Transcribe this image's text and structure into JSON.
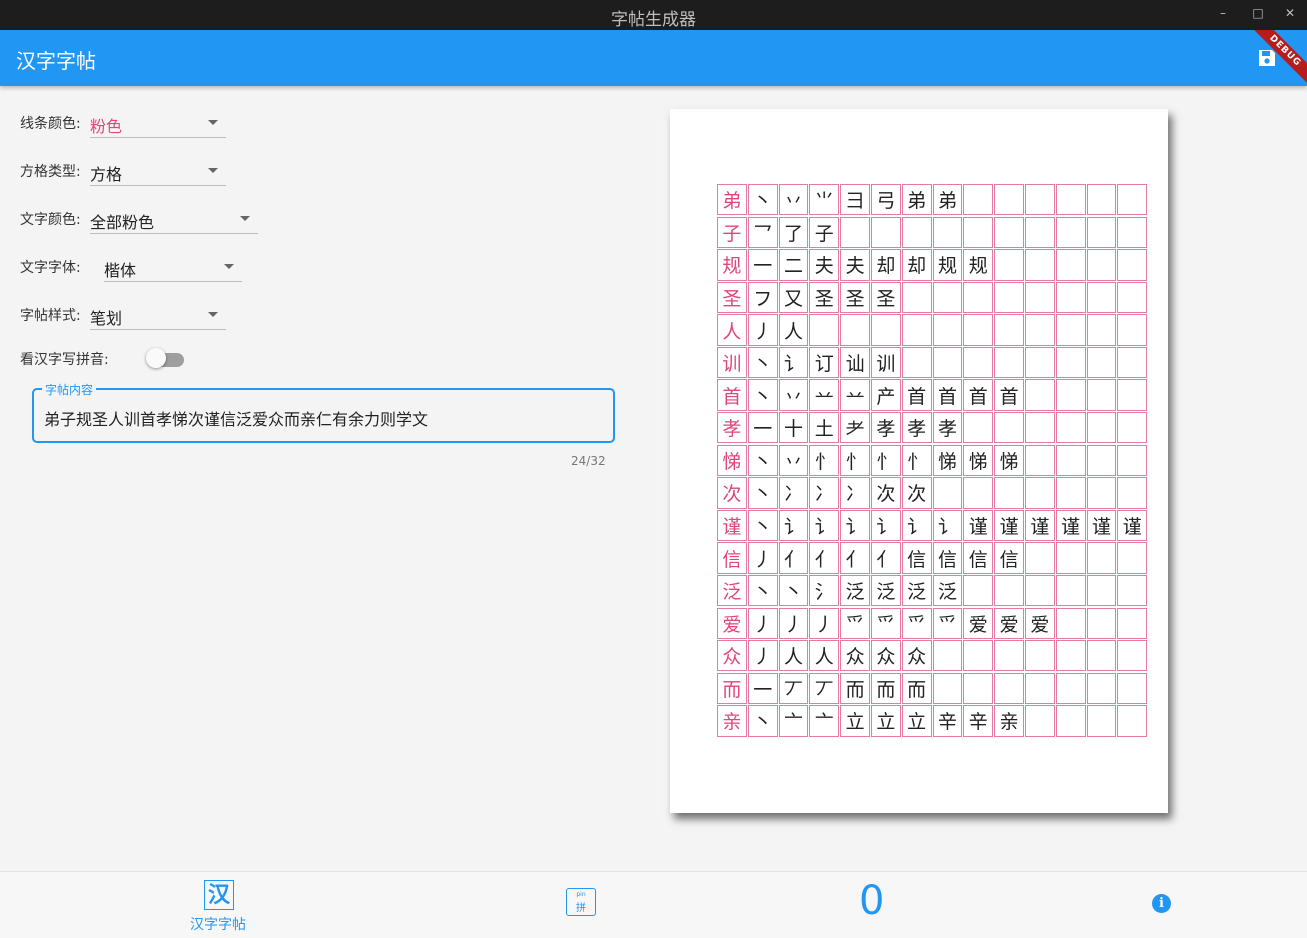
{
  "window": {
    "title": "字帖生成器",
    "minimize": "–",
    "maximize": "□",
    "close": "✕"
  },
  "appbar": {
    "title": "汉字字帖",
    "debug_label": "DEBUG"
  },
  "form": {
    "line_color": {
      "label": "线条颜色:",
      "value": "粉色",
      "value_color": "#e0457b"
    },
    "grid_type": {
      "label": "方格类型:",
      "value": "方格"
    },
    "text_color": {
      "label": "文字颜色:",
      "value": "全部粉色"
    },
    "font": {
      "label": "文字字体:",
      "value": "楷体"
    },
    "style": {
      "label": "字帖样式:",
      "value": "笔划"
    },
    "pinyin_toggle": {
      "label": "看汉字写拼音:",
      "on": false
    },
    "content": {
      "legend": "字帖内容",
      "value": "弟子规圣人训首孝悌次谨信泛爱众而亲仁有余力则学文",
      "counter": "24/32"
    }
  },
  "sheet": {
    "grid_color": "#e57ba2",
    "rows": [
      {
        "chars": [
          "弟",
          "丶",
          "丷",
          "⺌",
          "⺕",
          "弓",
          "弟",
          "弟"
        ]
      },
      {
        "chars": [
          "子",
          "乛",
          "了",
          "子"
        ]
      },
      {
        "chars": [
          "规",
          "一",
          "二",
          "夫",
          "夫",
          "却",
          "却",
          "规",
          "规"
        ]
      },
      {
        "chars": [
          "圣",
          "フ",
          "又",
          "圣",
          "圣",
          "圣"
        ]
      },
      {
        "chars": [
          "人",
          "丿",
          "人"
        ]
      },
      {
        "chars": [
          "训",
          "丶",
          "讠",
          "订",
          "讪",
          "训"
        ]
      },
      {
        "chars": [
          "首",
          "丶",
          "丷",
          "䒑",
          "䒑",
          "产",
          "首",
          "首",
          "首",
          "首"
        ]
      },
      {
        "chars": [
          "孝",
          "一",
          "十",
          "土",
          "耂",
          "孝",
          "孝",
          "孝"
        ]
      },
      {
        "chars": [
          "悌",
          "丶",
          "丷",
          "忄",
          "忄",
          "忄",
          "忄",
          "悌",
          "悌",
          "悌"
        ]
      },
      {
        "chars": [
          "次",
          "丶",
          "冫",
          "冫",
          "冫",
          "次",
          "次"
        ]
      },
      {
        "chars": [
          "谨",
          "丶",
          "讠",
          "讠",
          "讠",
          "讠",
          "讠",
          "讠",
          "谨",
          "谨",
          "谨",
          "谨",
          "谨",
          "谨"
        ]
      },
      {
        "chars": [
          "信",
          "丿",
          "亻",
          "亻",
          "亻",
          "亻",
          "信",
          "信",
          "信",
          "信"
        ]
      },
      {
        "chars": [
          "泛",
          "丶",
          "丶",
          "氵",
          "泛",
          "泛",
          "泛",
          "泛"
        ]
      },
      {
        "chars": [
          "爱",
          "丿",
          "丿",
          "丿",
          "爫",
          "爫",
          "爫",
          "爫",
          "爱",
          "爱",
          "爱"
        ]
      },
      {
        "chars": [
          "众",
          "丿",
          "人",
          "人",
          "众",
          "众",
          "众"
        ]
      },
      {
        "chars": [
          "而",
          "一",
          "丆",
          "丆",
          "而",
          "而",
          "而"
        ]
      },
      {
        "chars": [
          "亲",
          "丶",
          "亠",
          "亠",
          "立",
          "立",
          "立",
          "辛",
          "辛",
          "亲"
        ]
      }
    ]
  },
  "bottom_nav": {
    "han_icon": "汉",
    "han_label": "汉字字帖",
    "pin_small": "pin",
    "pin_big": "拼",
    "zero_label": "0",
    "info_glyph": "i"
  }
}
